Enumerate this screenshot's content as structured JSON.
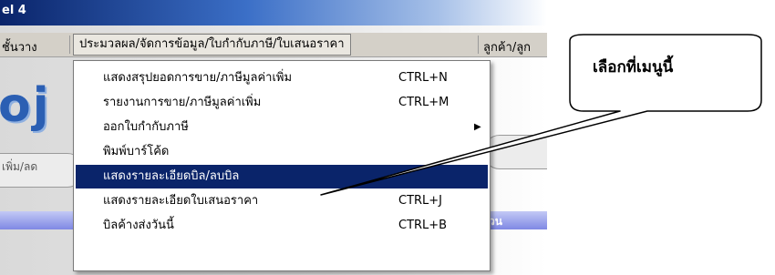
{
  "window": {
    "title_fragment": "el 4"
  },
  "menubar": {
    "items": [
      {
        "label": "ชั้นวาง"
      },
      {
        "label": "ประมวลผล/จัดการข้อมูล/ใบกำกับภาษี/ใบเสนอราคา"
      },
      {
        "label": "ลูกค้า/ลูก"
      }
    ]
  },
  "background": {
    "logo_fragment": "oj",
    "side_label": "เพิ่ม/ลด",
    "table_header_fragment": "วน"
  },
  "dropdown": {
    "items": [
      {
        "label": "แสดงสรุปยอดการขาย/ภาษีมูลค่าเพิ่ม",
        "shortcut": "CTRL+N"
      },
      {
        "label": "รายงานการขาย/ภาษีมูลค่าเพิ่ม",
        "shortcut": "CTRL+M"
      },
      {
        "label": "ออกใบกำกับภาษี",
        "shortcut": "",
        "submenu_arrow": "▶"
      },
      {
        "label": "พิมพ์บาร์โค้ด",
        "shortcut": ""
      },
      {
        "label": "แสดงรายละเอียดบิล/ลบบิล",
        "shortcut": "",
        "highlighted": true
      },
      {
        "label": "แสดงรายละเอียดใบเสนอราคา",
        "shortcut": "CTRL+J"
      },
      {
        "label": "บิลค้างส่งวันนี้",
        "shortcut": "CTRL+B"
      }
    ]
  },
  "callout": {
    "text": "เลือกที่เมนูนี้"
  },
  "colors": {
    "highlight_bg": "#0a246a",
    "menu_bg": "#d4d0c8",
    "titlebar": "#0a246a"
  }
}
